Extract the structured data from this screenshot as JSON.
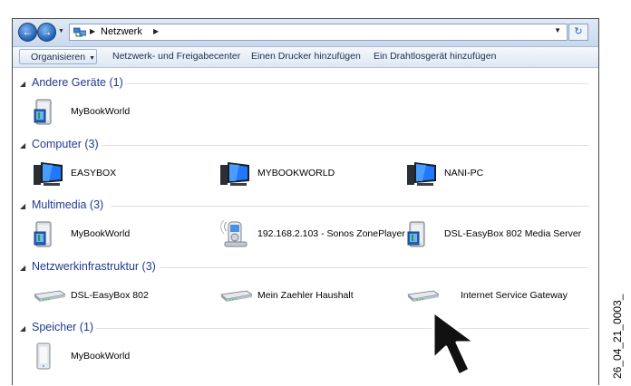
{
  "window": {
    "breadcrumb": "Netzwerk",
    "toolbar": {
      "organize": "Organisieren",
      "network_center": "Netzwerk- und Freigabecenter",
      "add_printer": "Einen Drucker hinzufügen",
      "add_wireless": "Ein Drahtlosgerät hinzufügen"
    }
  },
  "groups": [
    {
      "title": "Andere Geräte (1)",
      "items": [
        {
          "label": "MyBookWorld",
          "icon": "nas-drive-icon"
        }
      ]
    },
    {
      "title": "Computer (3)",
      "items": [
        {
          "label": "EASYBOX",
          "icon": "computer-icon"
        },
        {
          "label": "MYBOOKWORLD",
          "icon": "computer-icon"
        },
        {
          "label": "NANI-PC",
          "icon": "computer-icon"
        }
      ]
    },
    {
      "title": "Multimedia (3)",
      "items": [
        {
          "label": "MyBookWorld",
          "icon": "media-server-icon"
        },
        {
          "label": "192.168.2.103 - Sonos ZonePlayer",
          "icon": "media-player-icon"
        },
        {
          "label": "DSL-EasyBox 802 Media Server",
          "icon": "media-server-icon"
        }
      ]
    },
    {
      "title": "Netzwerkinfrastruktur (3)",
      "items": [
        {
          "label": "DSL-EasyBox 802",
          "icon": "router-icon"
        },
        {
          "label": "Mein Zaehler Haushalt",
          "icon": "router-icon"
        },
        {
          "label": "Internet Service Gateway",
          "icon": "router-icon"
        }
      ]
    },
    {
      "title": "Speicher (1)",
      "items": [
        {
          "label": "MyBookWorld",
          "icon": "storage-device-icon"
        }
      ]
    }
  ],
  "figure_code": "26_04_21_0003_",
  "colors": {
    "group_title": "#1f3a91",
    "toolbar_text": "#1a2e4d"
  }
}
